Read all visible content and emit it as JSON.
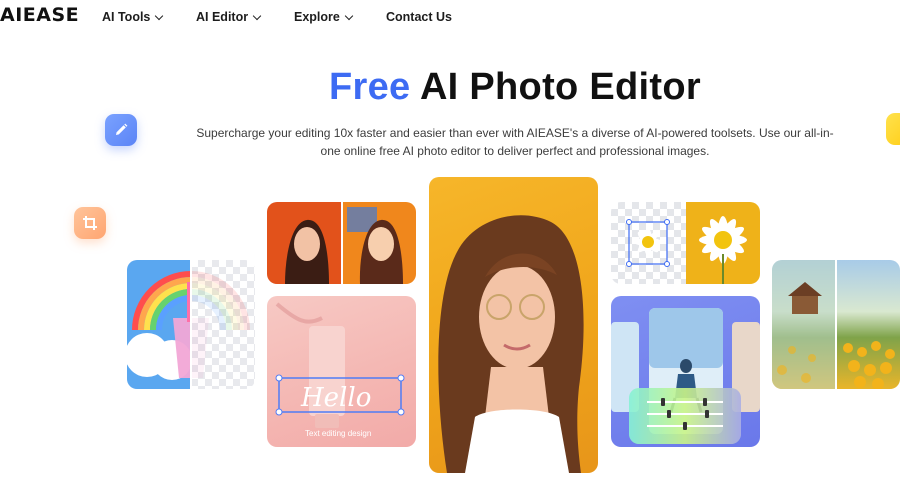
{
  "nav": {
    "logo": "AIEASE",
    "items": [
      {
        "label": "AI Tools"
      },
      {
        "label": "AI Editor"
      },
      {
        "label": "Explore"
      },
      {
        "label": "Contact Us"
      }
    ]
  },
  "hero": {
    "title_highlight": "Free",
    "title_rest": "AI Photo Editor",
    "subtitle": "Supercharge your editing 10x faster and easier than ever with AIEASE's a diverse of AI-powered toolsets. Use our all-in-one online free AI photo editor to deliver perfect and professional images."
  },
  "cards": {
    "pink_card_caption": "Text editing design",
    "pink_card_script": "Hello"
  },
  "icons": {
    "pencil": "pencil-icon",
    "crop": "crop-icon"
  },
  "colors": {
    "accent_blue": "#3d6bf3",
    "pencil_chip": "#6b93fa",
    "crop_chip": "#ffb07f",
    "yellow_chip": "#ffd92e"
  }
}
